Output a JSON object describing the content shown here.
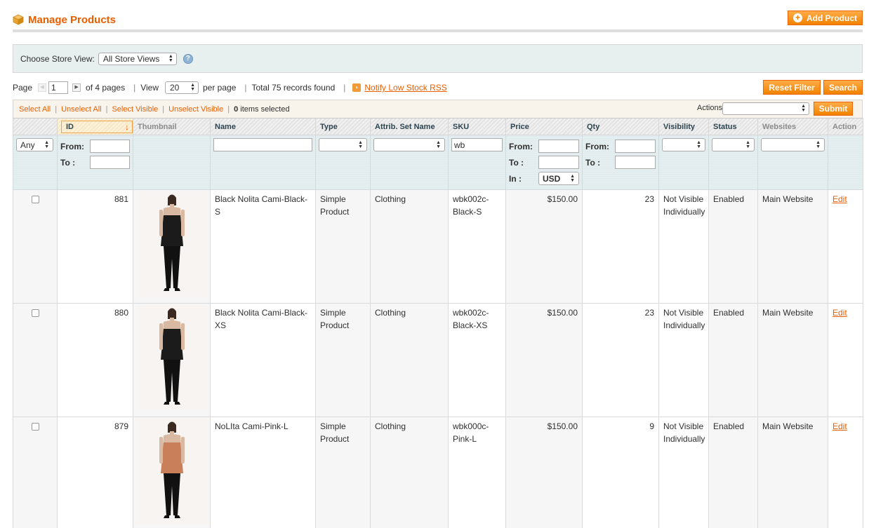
{
  "header": {
    "title": "Manage Products",
    "add_button": "Add Product"
  },
  "store_switcher": {
    "label": "Choose Store View:",
    "selected": "All Store Views"
  },
  "pager": {
    "page_label": "Page",
    "page_value": "1",
    "of_pages": "of 4 pages",
    "view_label": "View",
    "per_page_value": "20",
    "per_page_label": "per page",
    "total": "Total 75 records found",
    "rss": "Notify Low Stock RSS",
    "reset_filter": "Reset Filter",
    "search": "Search"
  },
  "massaction": {
    "select_all": "Select All",
    "unselect_all": "Unselect All",
    "select_visible": "Select Visible",
    "unselect_visible": "Unselect Visible",
    "selected_count": "0",
    "selected_suffix": "items selected",
    "actions_label": "Actions",
    "submit": "Submit"
  },
  "columns": {
    "id": "ID",
    "thumbnail": "Thumbnail",
    "name": "Name",
    "type": "Type",
    "attrib_set": "Attrib. Set Name",
    "sku": "SKU",
    "price": "Price",
    "qty": "Qty",
    "visibility": "Visibility",
    "status": "Status",
    "websites": "Websites",
    "action": "Action"
  },
  "filters": {
    "any": "Any",
    "from": "From:",
    "to": "To :",
    "in": "In :",
    "currency": "USD",
    "sku_value": "wb"
  },
  "rows": [
    {
      "id": "881",
      "name": "Black Nolita Cami-Black-S",
      "type": "Simple Product",
      "attrib_set": "Clothing",
      "sku": "wbk002c-Black-S",
      "price": "$150.00",
      "qty": "23",
      "visibility": "Not Visible Individually",
      "status": "Enabled",
      "websites": "Main Website",
      "action": "Edit",
      "top_color": "#1b1b1b"
    },
    {
      "id": "880",
      "name": "Black Nolita Cami-Black-XS",
      "type": "Simple Product",
      "attrib_set": "Clothing",
      "sku": "wbk002c-Black-XS",
      "price": "$150.00",
      "qty": "23",
      "visibility": "Not Visible Individually",
      "status": "Enabled",
      "websites": "Main Website",
      "action": "Edit",
      "top_color": "#1b1b1b"
    },
    {
      "id": "879",
      "name": "NoLIta Cami-Pink-L",
      "type": "Simple Product",
      "attrib_set": "Clothing",
      "sku": "wbk000c-Pink-L",
      "price": "$150.00",
      "qty": "9",
      "visibility": "Not Visible Individually",
      "status": "Enabled",
      "websites": "Main Website",
      "action": "Edit",
      "top_color": "#c9805a"
    }
  ]
}
